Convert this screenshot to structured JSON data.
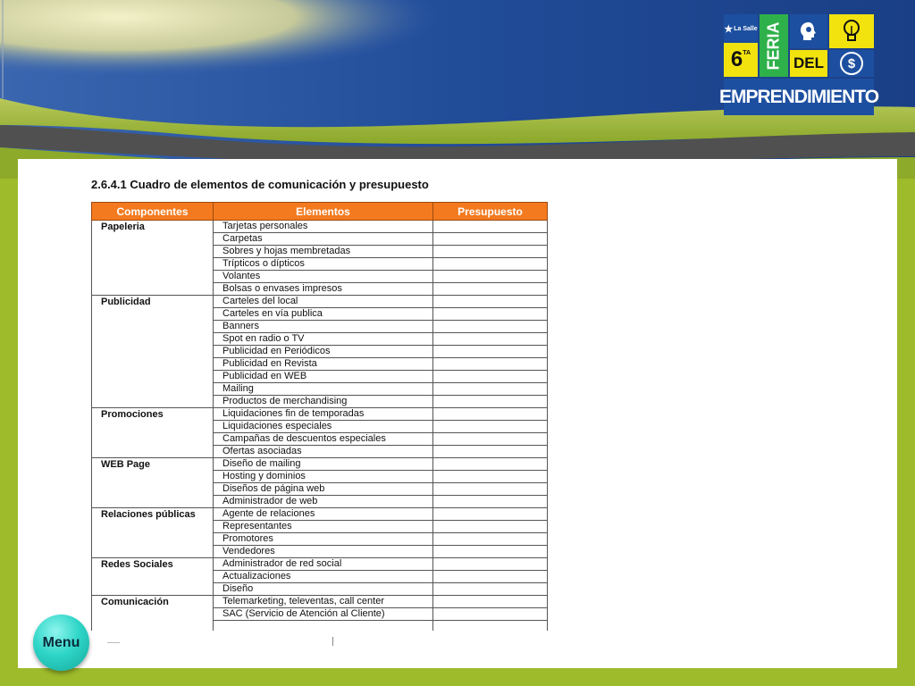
{
  "colors": {
    "header_blue": "#1e4a95",
    "page_green": "#9dbb2a",
    "table_header_orange": "#f47a1f",
    "logo_blue": "#1d4fa0",
    "logo_yellow": "#f2e30f",
    "logo_green": "#2eb14a",
    "menu_teal": "#2fd6c8"
  },
  "logo": {
    "la_salle": "La Salle",
    "edition": "6",
    "edition_suffix": "TA",
    "feria": "FERIA",
    "del": "DEL",
    "emprendimiento": "EMPRENDIMIENTO",
    "icons": [
      "star-icon",
      "head-icon",
      "lightbulb-icon",
      "dollar-icon"
    ]
  },
  "section_title": "2.6.4.1 Cuadro de elementos de comunicación y presupuesto",
  "table": {
    "headers": [
      "Componentes",
      "Elementos",
      "Presupuesto"
    ],
    "groups": [
      {
        "component": "Papeleria",
        "elements": [
          "Tarjetas personales",
          "Carpetas",
          "Sobres y hojas membretadas",
          "Trípticos o dípticos",
          "Volantes",
          "Bolsas o envases impresos"
        ]
      },
      {
        "component": "Publicidad",
        "elements": [
          "Carteles del local",
          "Carteles en vía publica",
          "Banners",
          "Spot en radio o TV",
          "Publicidad en Periódicos",
          "Publicidad en Revista",
          "Publicidad en WEB",
          "Mailing",
          "Productos de merchandising"
        ]
      },
      {
        "component": "Promociones",
        "elements": [
          "Liquidaciones fin de temporadas",
          "Liquidaciones especiales",
          "Campañas de descuentos especiales",
          "Ofertas asociadas"
        ]
      },
      {
        "component": "WEB Page",
        "elements": [
          "Diseño de mailing",
          "Hosting y dominios",
          "Diseños de página web",
          "Administrador de web"
        ]
      },
      {
        "component": "Relaciones públicas",
        "elements": [
          "Agente de relaciones",
          "Representantes",
          "Promotores",
          "Vendedores"
        ]
      },
      {
        "component": "Redes Sociales",
        "elements": [
          "Administrador de red social",
          "Actualizaciones",
          "Diseño"
        ]
      },
      {
        "component": "Comunicación",
        "elements": [
          "Telemarketing, televentas, call center",
          "SAC (Servicio de Atención al Cliente)"
        ]
      }
    ]
  },
  "menu_button": "Menu"
}
